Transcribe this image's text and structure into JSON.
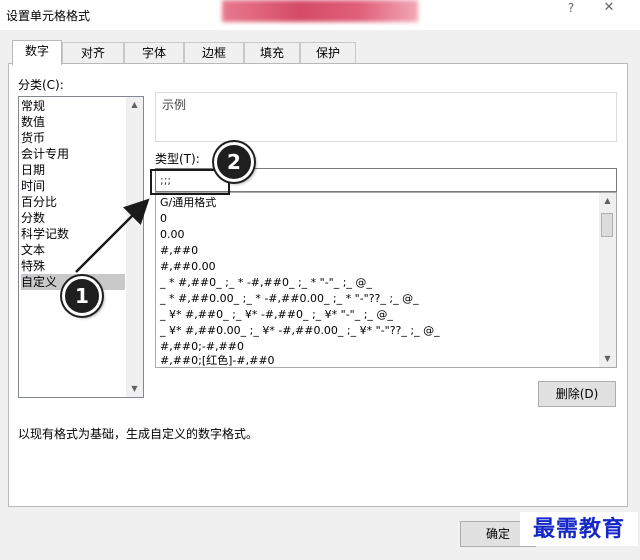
{
  "window": {
    "title": "设置单元格格式",
    "help_glyph": "?",
    "close_glyph": "✕"
  },
  "tabs": [
    {
      "label": "数字",
      "active": true
    },
    {
      "label": "对齐"
    },
    {
      "label": "字体"
    },
    {
      "label": "边框"
    },
    {
      "label": "填充"
    },
    {
      "label": "保护"
    }
  ],
  "category": {
    "label": "分类(C):",
    "items": [
      "常规",
      "数值",
      "货币",
      "会计专用",
      "日期",
      "时间",
      "百分比",
      "分数",
      "科学记数",
      "文本",
      "特殊",
      "自定义"
    ],
    "selected": "自定义"
  },
  "sample": {
    "label": "示例"
  },
  "type": {
    "label": "类型(T):",
    "value": ";;;",
    "formats": [
      "G/通用格式",
      "0",
      "0.00",
      "#,##0",
      "#,##0.00",
      "_ * #,##0_ ;_ * -#,##0_ ;_ * \"-\"_ ;_ @_",
      "_ * #,##0.00_ ;_ * -#,##0.00_ ;_ * \"-\"??_ ;_ @_",
      "_ ¥* #,##0_ ;_ ¥* -#,##0_ ;_ ¥* \"-\"_ ;_ @_",
      "_ ¥* #,##0.00_ ;_ ¥* -#,##0.00_ ;_ ¥* \"-\"??_ ;_ @_",
      "#,##0;-#,##0",
      "#,##0;[红色]-#,##0"
    ]
  },
  "delete_button": "删除(D)",
  "description": "以现有格式为基础，生成自定义的数字格式。",
  "ok_button": "确定",
  "annotations": {
    "marker1": "1",
    "marker2": "2"
  },
  "watermark": "最需教育"
}
